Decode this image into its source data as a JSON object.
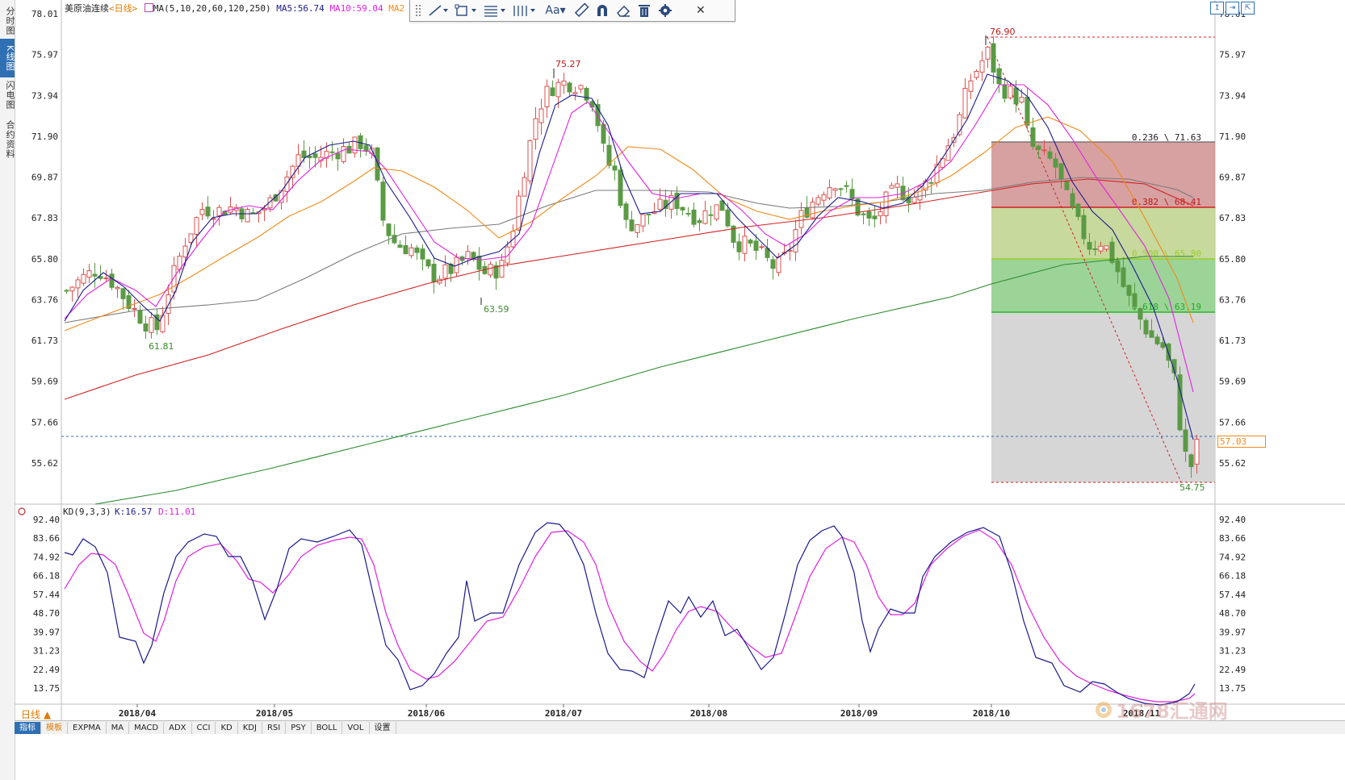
{
  "side_tabs": [
    {
      "label": "分时图",
      "active": false
    },
    {
      "label": "K线图",
      "active": true
    },
    {
      "label": "闪电图",
      "active": false
    },
    {
      "label": "合约资料",
      "active": false
    }
  ],
  "legend": {
    "instrument": "美原油连续",
    "period_tag": "<日线>",
    "ma_params": "MA(5,10,20,60,120,250)",
    "ma5": "MA5:56.74",
    "ma10": "MA10:59.04",
    "ma20": "MA2"
  },
  "kd_legend": {
    "name": "KD(9,3,3)",
    "k": "K:16.57",
    "d": "D:11.01"
  },
  "toolbar": {
    "text_tool": "Aa▾",
    "close": "✕"
  },
  "price_axis": [
    "78.01",
    "75.97",
    "73.94",
    "71.90",
    "69.87",
    "67.83",
    "65.80",
    "63.76",
    "61.73",
    "59.69",
    "57.66",
    "55.62"
  ],
  "kd_axis": [
    "92.40",
    "83.66",
    "74.92",
    "66.18",
    "57.44",
    "48.70",
    "39.97",
    "31.23",
    "22.49",
    "13.75"
  ],
  "date_labels": [
    "2018/04",
    "2018/05",
    "2018/06",
    "2018/07",
    "2018/08",
    "2018/09",
    "2018/10",
    "2018/11"
  ],
  "annotations": {
    "high1": "75.27",
    "high2": "76.90",
    "low1": "61.81",
    "low2": "63.59",
    "low3": "54.75"
  },
  "fib_labels": [
    "0.236 \\ 71.63",
    "0.382 \\ 68.41",
    "0.500 \\ 65.80",
    "0.618 \\ 63.19"
  ],
  "current_price": "57.03",
  "period_label": "日线 ▲",
  "bottom_tabs": [
    {
      "label": "指标",
      "active": true
    },
    {
      "label": "模板",
      "active": false,
      "orange": true
    },
    {
      "label": "EXPMA"
    },
    {
      "label": "MA"
    },
    {
      "label": "MACD"
    },
    {
      "label": "ADX"
    },
    {
      "label": "CCI"
    },
    {
      "label": "KD"
    },
    {
      "label": "KDJ"
    },
    {
      "label": "RSI"
    },
    {
      "label": "PSY"
    },
    {
      "label": "BOLL"
    },
    {
      "label": "VOL"
    },
    {
      "label": "设置"
    }
  ],
  "watermark": "1678汇通网",
  "colors": {
    "up": "#d9534f",
    "down": "#5a9a44",
    "ma5": "#1a1a8c",
    "ma10": "#e020e0",
    "ma20": "#f08a1a",
    "ma60": "#7a7a7a",
    "ma120": "#d22020",
    "ma250": "#2e8b2e",
    "k_line": "#1a1a8c",
    "d_line": "#e020e0"
  }
}
